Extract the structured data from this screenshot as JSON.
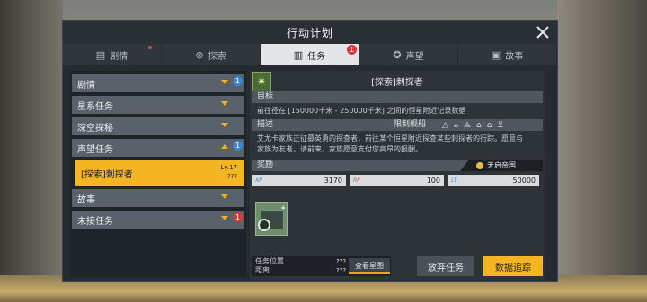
{
  "window": {
    "title": "行动计划"
  },
  "tabs": [
    {
      "label": "剧情",
      "icon": "book-icon"
    },
    {
      "label": "探索",
      "icon": "binoculars-icon"
    },
    {
      "label": "任务",
      "icon": "clipboard-icon",
      "badge": "1"
    },
    {
      "label": "声望",
      "icon": "medal-icon"
    },
    {
      "label": "故事",
      "icon": "notebook-icon"
    }
  ],
  "sidebar": {
    "categories": [
      {
        "label": "剧情",
        "badge": "1"
      },
      {
        "label": "星系任务"
      },
      {
        "label": "深空探秘"
      },
      {
        "label": "声望任务",
        "badge": "1"
      },
      {
        "label": "故事"
      },
      {
        "label": "未接任务",
        "badge": "1"
      }
    ],
    "selected_mission": {
      "label": "[探索]刺探者",
      "level": "Lv.17",
      "sub": "???"
    }
  },
  "detail": {
    "title": "[探索]刺探者",
    "objective_header": "目标",
    "objective_text": "前往径在 [150000千米 - 250000千米] 之间的恒星附近记录数据",
    "description_header": "描述",
    "limit_label": "限制舰船",
    "description_text_line1": "艾尤卡家族正征募英勇的探查者，前往某个恒星附近探查某些刺探者的行踪。愿意与",
    "description_text_line2": "家族为友者，请前来，家族愿意支付您高昂的报酬。",
    "reward_header": "奖励",
    "faction": "天启帝国",
    "rewards": {
      "xp_label": "XP",
      "xp_value": "3170",
      "rp_label": "RP",
      "rp_value": "100",
      "lt_label": "LT",
      "lt_value": "50000"
    }
  },
  "bottom": {
    "location_label": "任务位置",
    "distance_label": "距离",
    "location_value": "???",
    "distance_value": "???",
    "map_button": "查看星图",
    "give_up_button": "放弃任务",
    "track_button": "数据追踪"
  }
}
